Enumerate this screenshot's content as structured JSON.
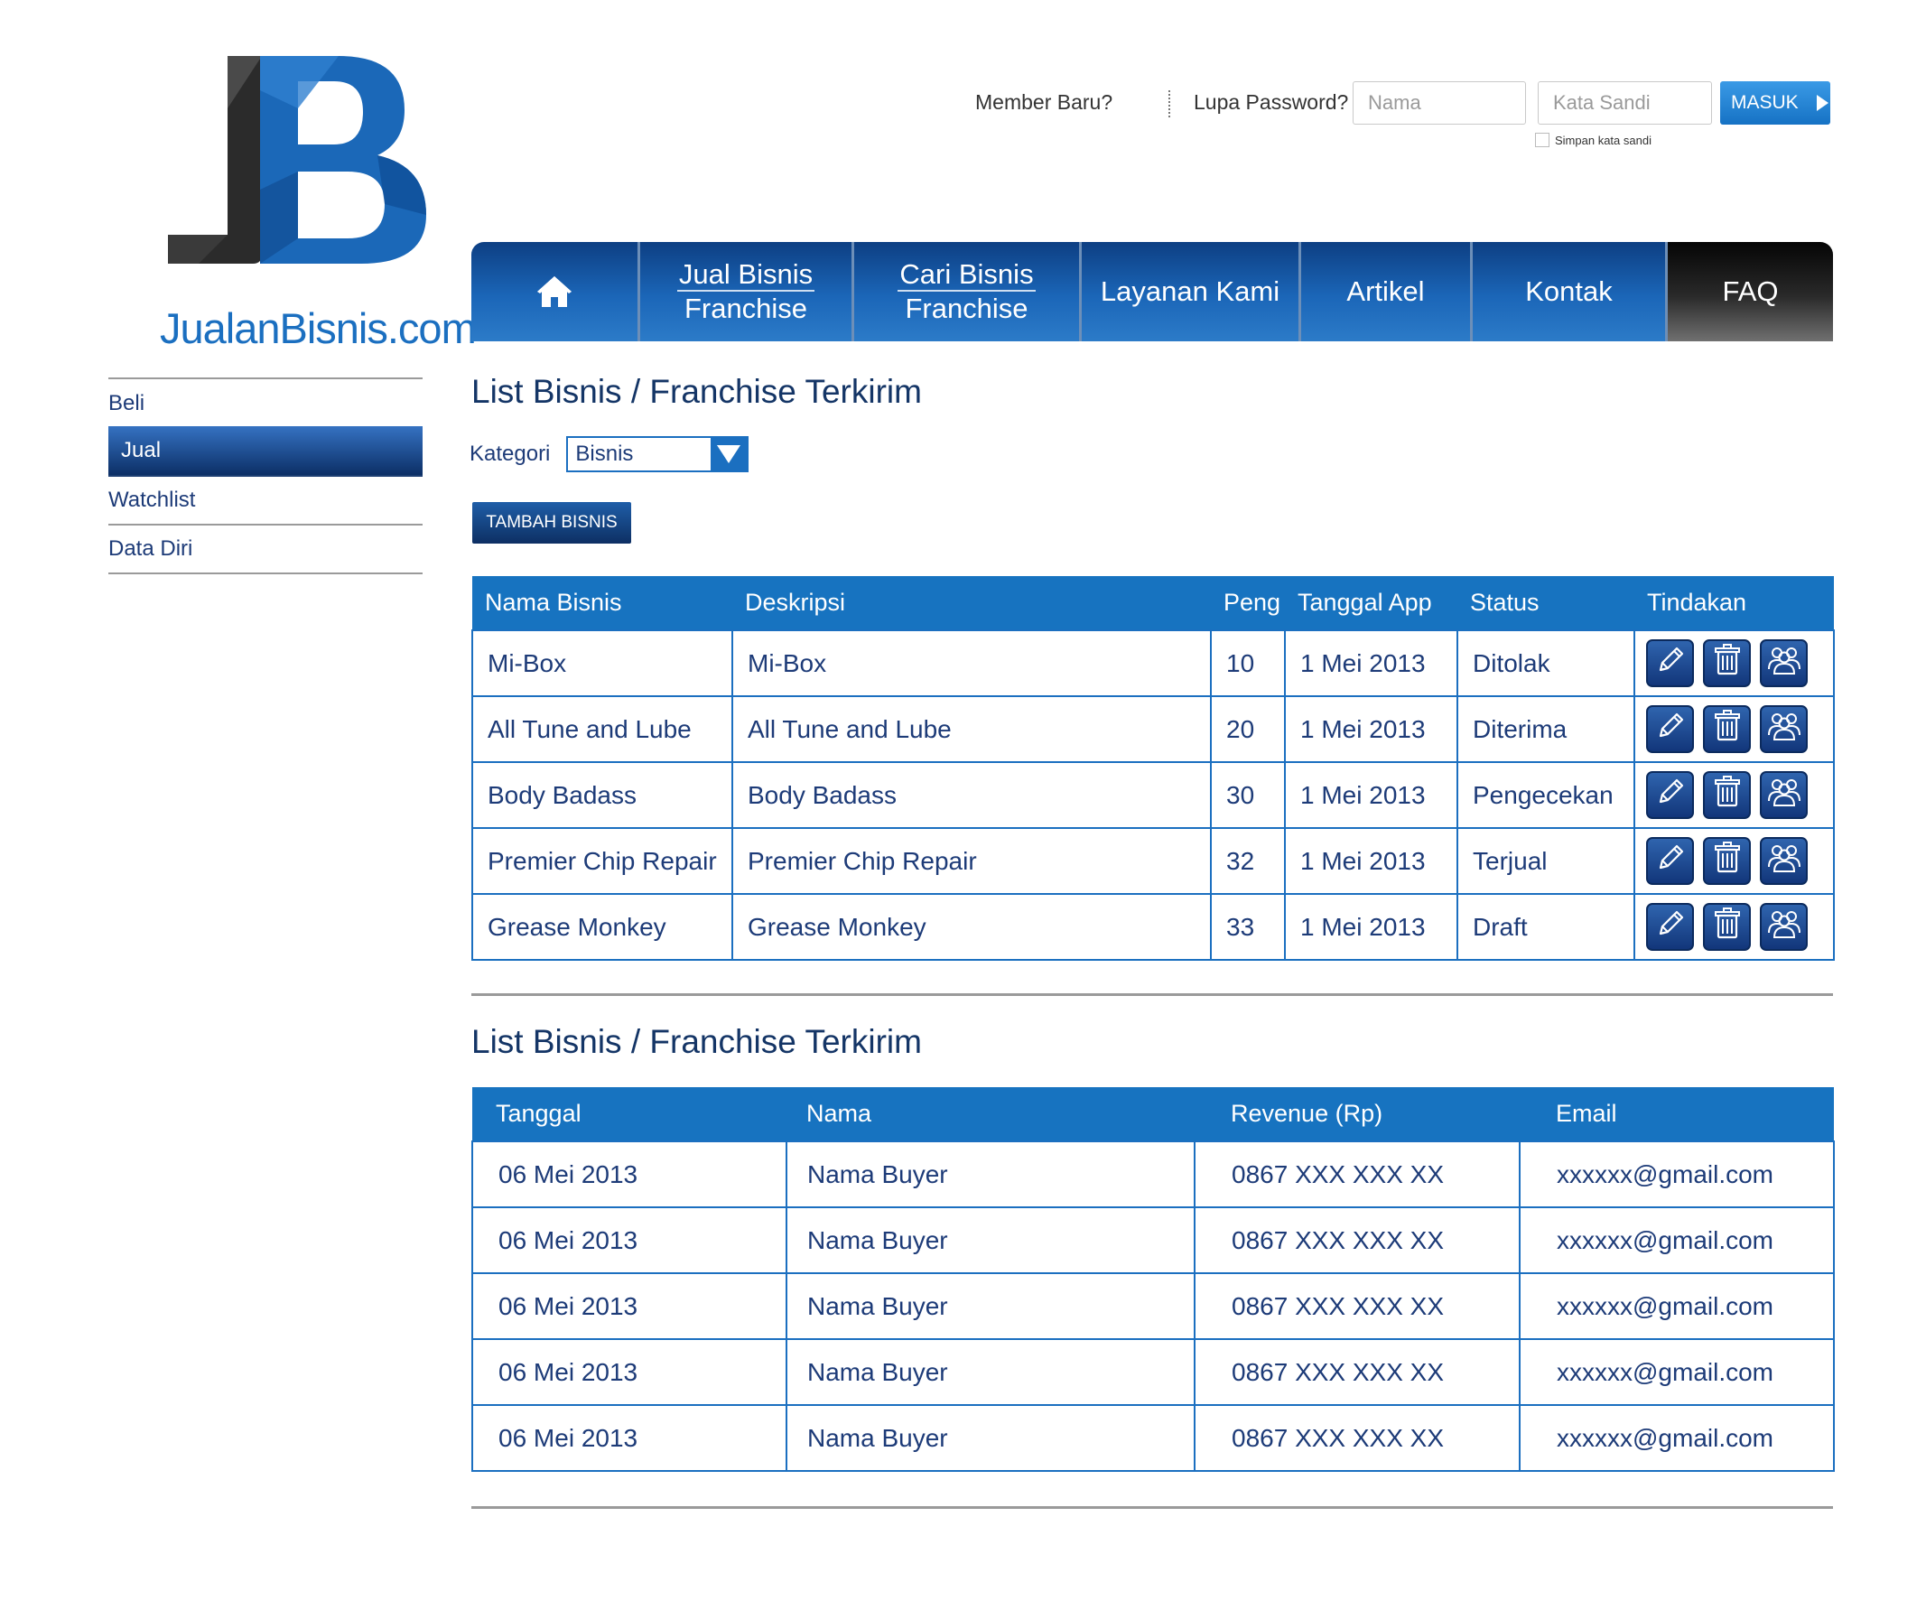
{
  "brand": {
    "logo_letters": "JB",
    "name_main": "JualanBisnis",
    "name_tld": ".com"
  },
  "login": {
    "member_baru": "Member Baru?",
    "lupa_password": "Lupa Password?",
    "nama_placeholder": "Nama",
    "sandi_placeholder": "Kata Sandi",
    "masuk_label": "MASUK",
    "remember_label": "Simpan kata sandi"
  },
  "nav": {
    "home_icon": "home-icon",
    "jual_line1": "Jual Bisnis",
    "jual_line2": "Franchise",
    "cari_line1": "Cari Bisnis",
    "cari_line2": "Franchise",
    "layanan": "Layanan Kami",
    "artikel": "Artikel",
    "kontak": "Kontak",
    "faq": "FAQ"
  },
  "sidebar": {
    "items": [
      {
        "label": "Beli"
      },
      {
        "label": "Jual"
      },
      {
        "label": "Watchlist"
      },
      {
        "label": "Data Diri"
      }
    ]
  },
  "section1": {
    "title": "List Bisnis / Franchise Terkirim",
    "kategori_label": "Kategori",
    "kategori_value": "Bisnis",
    "tambah_label": "TAMBAH BISNIS",
    "headers": {
      "nama": "Nama Bisnis",
      "deskripsi": "Deskripsi",
      "peng": "Peng",
      "tanggal": "Tanggal App",
      "status": "Status",
      "tindakan": "Tindakan"
    },
    "rows": [
      {
        "nama": "Mi-Box",
        "deskripsi": "Mi-Box",
        "peng": "10",
        "tanggal": "1 Mei 2013",
        "status": "Ditolak"
      },
      {
        "nama": "All Tune and Lube",
        "deskripsi": "All Tune and Lube",
        "peng": "20",
        "tanggal": "1 Mei 2013",
        "status": "Diterima"
      },
      {
        "nama": "Body Badass",
        "deskripsi": "Body Badass",
        "peng": "30",
        "tanggal": "1 Mei 2013",
        "status": "Pengecekan"
      },
      {
        "nama": "Premier Chip Repair",
        "deskripsi": "Premier Chip Repair",
        "peng": "32",
        "tanggal": "1 Mei 2013",
        "status": "Terjual"
      },
      {
        "nama": "Grease Monkey",
        "deskripsi": "Grease Monkey",
        "peng": "33",
        "tanggal": "1 Mei 2013",
        "status": "Draft"
      }
    ],
    "action_icons": [
      "pencil-icon",
      "trash-icon",
      "users-icon"
    ]
  },
  "section2": {
    "title": "List Bisnis / Franchise Terkirim",
    "headers": {
      "tanggal": "Tanggal",
      "nama": "Nama",
      "revenue": "Revenue (Rp)",
      "email": "Email"
    },
    "rows": [
      {
        "tanggal": "06 Mei 2013",
        "nama": "Nama Buyer",
        "revenue": "0867 XXX XXX XX",
        "email": "xxxxxx@gmail.com"
      },
      {
        "tanggal": "06 Mei 2013",
        "nama": "Nama Buyer",
        "revenue": "0867 XXX XXX XX",
        "email": "xxxxxx@gmail.com"
      },
      {
        "tanggal": "06 Mei 2013",
        "nama": "Nama Buyer",
        "revenue": "0867 XXX XXX XX",
        "email": "xxxxxx@gmail.com"
      },
      {
        "tanggal": "06 Mei 2013",
        "nama": "Nama Buyer",
        "revenue": "0867 XXX XXX XX",
        "email": "xxxxxx@gmail.com"
      },
      {
        "tanggal": "06 Mei 2013",
        "nama": "Nama Buyer",
        "revenue": "0867 XXX XXX XX",
        "email": "xxxxxx@gmail.com"
      }
    ]
  },
  "colors": {
    "primary_blue": "#1773c0",
    "dark_navy": "#0d2f63",
    "text_navy": "#1d3b78",
    "faq_black": "#050505"
  }
}
